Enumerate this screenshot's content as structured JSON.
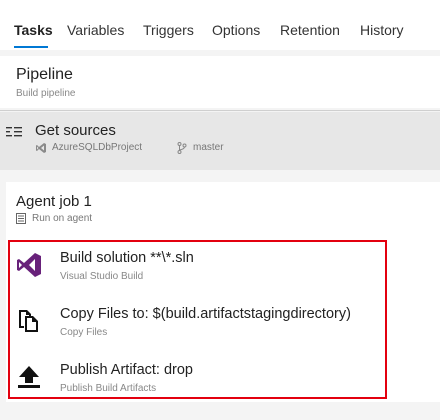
{
  "tabs": [
    {
      "label": "Tasks",
      "active": true
    },
    {
      "label": "Variables",
      "active": false
    },
    {
      "label": "Triggers",
      "active": false
    },
    {
      "label": "Options",
      "active": false
    },
    {
      "label": "Retention",
      "active": false
    },
    {
      "label": "History",
      "active": false
    }
  ],
  "pipeline": {
    "title": "Pipeline",
    "subtitle": "Build pipeline"
  },
  "get_sources": {
    "title": "Get sources",
    "repository": "AzureSQLDbProject",
    "branch": "master",
    "icons": {
      "section": "list-icon",
      "repo": "vs-repo-icon",
      "branch": "branch-icon"
    }
  },
  "agent_job": {
    "title": "Agent job 1",
    "subtitle": "Run on agent",
    "icon": "agent-icon"
  },
  "tasks": [
    {
      "name": "Build solution **\\*.sln",
      "description": "Visual Studio Build",
      "icon": "visual-studio-icon"
    },
    {
      "name": "Copy Files to: $(build.artifactstagingdirectory)",
      "description": "Copy Files",
      "icon": "copy-files-icon"
    },
    {
      "name": "Publish Artifact: drop",
      "description": "Publish Build Artifacts",
      "icon": "upload-icon"
    }
  ],
  "colors": {
    "accent": "#0078d4",
    "highlight": "#e3000f",
    "visual_studio": "#68217a"
  }
}
